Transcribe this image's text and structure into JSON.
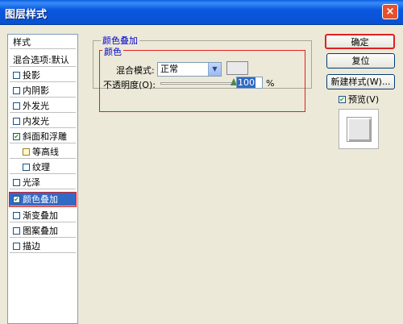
{
  "window": {
    "title": "图层样式",
    "close_glyph": "×"
  },
  "sidebar": {
    "header": "样式",
    "blend_default": "混合选项:默认",
    "items": [
      {
        "label": "投影",
        "checked": false
      },
      {
        "label": "内阴影",
        "checked": false
      },
      {
        "label": "外发光",
        "checked": false
      },
      {
        "label": "内发光",
        "checked": false
      },
      {
        "label": "斜面和浮雕",
        "checked": true
      },
      {
        "label": "等高线",
        "checked": false
      },
      {
        "label": "纹理",
        "checked": false
      },
      {
        "label": "光泽",
        "checked": false
      },
      {
        "label": "颜色叠加",
        "checked": true,
        "selected": true
      },
      {
        "label": "渐变叠加",
        "checked": false
      },
      {
        "label": "图案叠加",
        "checked": false
      },
      {
        "label": "描边",
        "checked": false
      }
    ]
  },
  "panel": {
    "outer_group_title": "颜色叠加",
    "inner_group_title": "颜色",
    "blend_mode_label": "混合模式:",
    "blend_mode_value": "正常",
    "opacity_label": "不透明度(O):",
    "opacity_value": "100",
    "opacity_unit": "%",
    "opacity_fraction": 1.0,
    "swatch_color": "#e9e9e9"
  },
  "buttons": {
    "ok": "确定",
    "reset": "复位",
    "new_style": "新建样式(W)...",
    "preview_label": "预览(V)",
    "preview_checked": true
  },
  "colors": {
    "selection": "#316ac5",
    "highlight_outline": "#e02020",
    "group_title": "#0000c8"
  }
}
